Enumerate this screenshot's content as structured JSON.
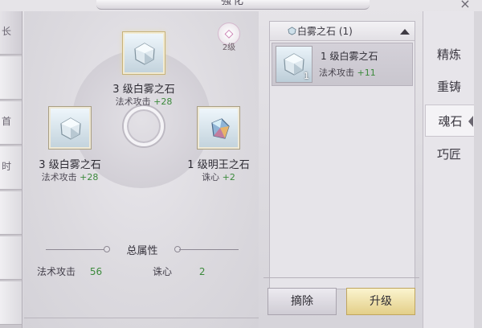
{
  "window": {
    "title": "强化",
    "close_glyph": "×"
  },
  "left_tabs": [
    {
      "label": "长"
    },
    {
      "label": ""
    },
    {
      "label": "首"
    },
    {
      "label": "时"
    },
    {
      "label": ""
    },
    {
      "label": ""
    },
    {
      "label": ""
    }
  ],
  "level_badge": {
    "label": "2级"
  },
  "slots": {
    "top": {
      "name": "3 级白雾之石",
      "stat_label": "法术攻击",
      "stat_value": "+28",
      "icon": "white-mist-stone-icon"
    },
    "left": {
      "name": "3 级白雾之石",
      "stat_label": "法术攻击",
      "stat_value": "+28",
      "icon": "white-mist-stone-icon"
    },
    "right": {
      "name": "1 级明王之石",
      "stat_label": "诛心",
      "stat_value": "+2",
      "icon": "ming-wang-stone-icon"
    }
  },
  "totals": {
    "title": "总属性",
    "attrs": [
      {
        "label": "法术攻击",
        "value": "56"
      },
      {
        "label": "诛心",
        "value": "2"
      }
    ]
  },
  "list": {
    "header": "白雾之石 (1)",
    "items": [
      {
        "name": "1 级白雾之石",
        "stat_label": "法术攻击",
        "stat_value": "+11",
        "count": "1"
      }
    ]
  },
  "buttons": {
    "remove": "摘除",
    "upgrade": "升级"
  },
  "right_tabs": [
    {
      "label": "精炼",
      "active": false
    },
    {
      "label": "重铸",
      "active": false
    },
    {
      "label": "魂石",
      "active": true
    },
    {
      "label": "巧匠",
      "active": false
    }
  ],
  "colors": {
    "stat_green": "#3c8a3c",
    "upgrade_gold": "#e3cf88",
    "badge_pink": "#c26aa6"
  }
}
